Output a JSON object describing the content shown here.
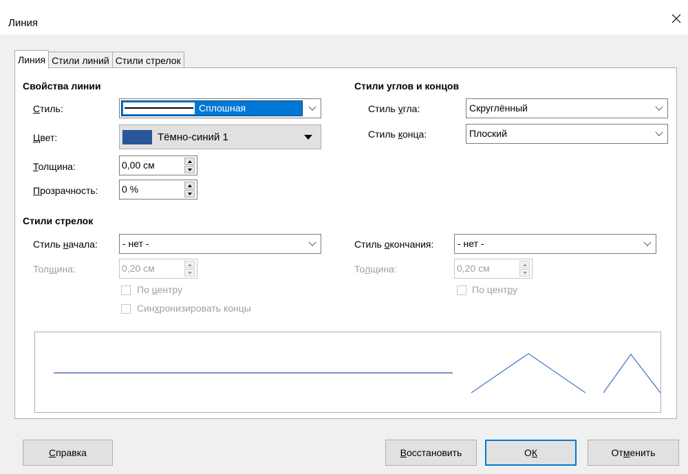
{
  "window": {
    "title": "Линия"
  },
  "tabs": [
    "Линия",
    "Стили линий",
    "Стили стрелок"
  ],
  "line_props": {
    "title": "Свойства линии",
    "style_label_pre": "",
    "style_label_u": "С",
    "style_label_post": "тиль:",
    "style_value": "Сплошная",
    "color_label_u": "Ц",
    "color_label_post": "вет:",
    "color_value": "Тёмно-синий 1",
    "color_hex": "#2a5599",
    "width_label_u": "Т",
    "width_label_post": "олщина:",
    "width_value": "0,00 см",
    "transparency_label_u": "П",
    "transparency_label_post": "розрачность:",
    "transparency_value": "0 %"
  },
  "corner": {
    "title": "Стили углов и концов",
    "corner_label_pre": "Стиль ",
    "corner_label_u": "у",
    "corner_label_post": "гла:",
    "corner_value": "Скруглённый",
    "cap_label_pre": "Стиль ",
    "cap_label_u": "к",
    "cap_label_post": "онца:",
    "cap_value": "Плоский"
  },
  "arrows": {
    "title": "Стили стрелок",
    "start_label_pre": "Стиль ",
    "start_label_u": "н",
    "start_label_post": "ачала:",
    "start_value": "- нет -",
    "start_width_label_pre": "Тол",
    "start_width_label_u": "щ",
    "start_width_label_post": "ина:",
    "start_width_value": "0,20 см",
    "center_start_pre": "По ",
    "center_start_u": "ц",
    "center_start_post": "ентру",
    "sync_pre": "Син",
    "sync_u": "х",
    "sync_post": "ронизировать концы",
    "end_label_pre": "Стиль ",
    "end_label_u": "о",
    "end_label_post": "кончания:",
    "end_value": "- нет -",
    "end_width_label_pre": "То",
    "end_width_label_u": "л",
    "end_width_label_post": "щина:",
    "end_width_value": "0,20 см",
    "center_end_pre": "По цент",
    "center_end_u": "р",
    "center_end_post": "у"
  },
  "buttons": {
    "help_u": "С",
    "help_post": "правка",
    "reset_u": "В",
    "reset_post": "осстановить",
    "ok_pre": "О",
    "ok_u": "К",
    "ok_post": "",
    "cancel_pre": "От",
    "cancel_u": "м",
    "cancel_post": "енить"
  }
}
